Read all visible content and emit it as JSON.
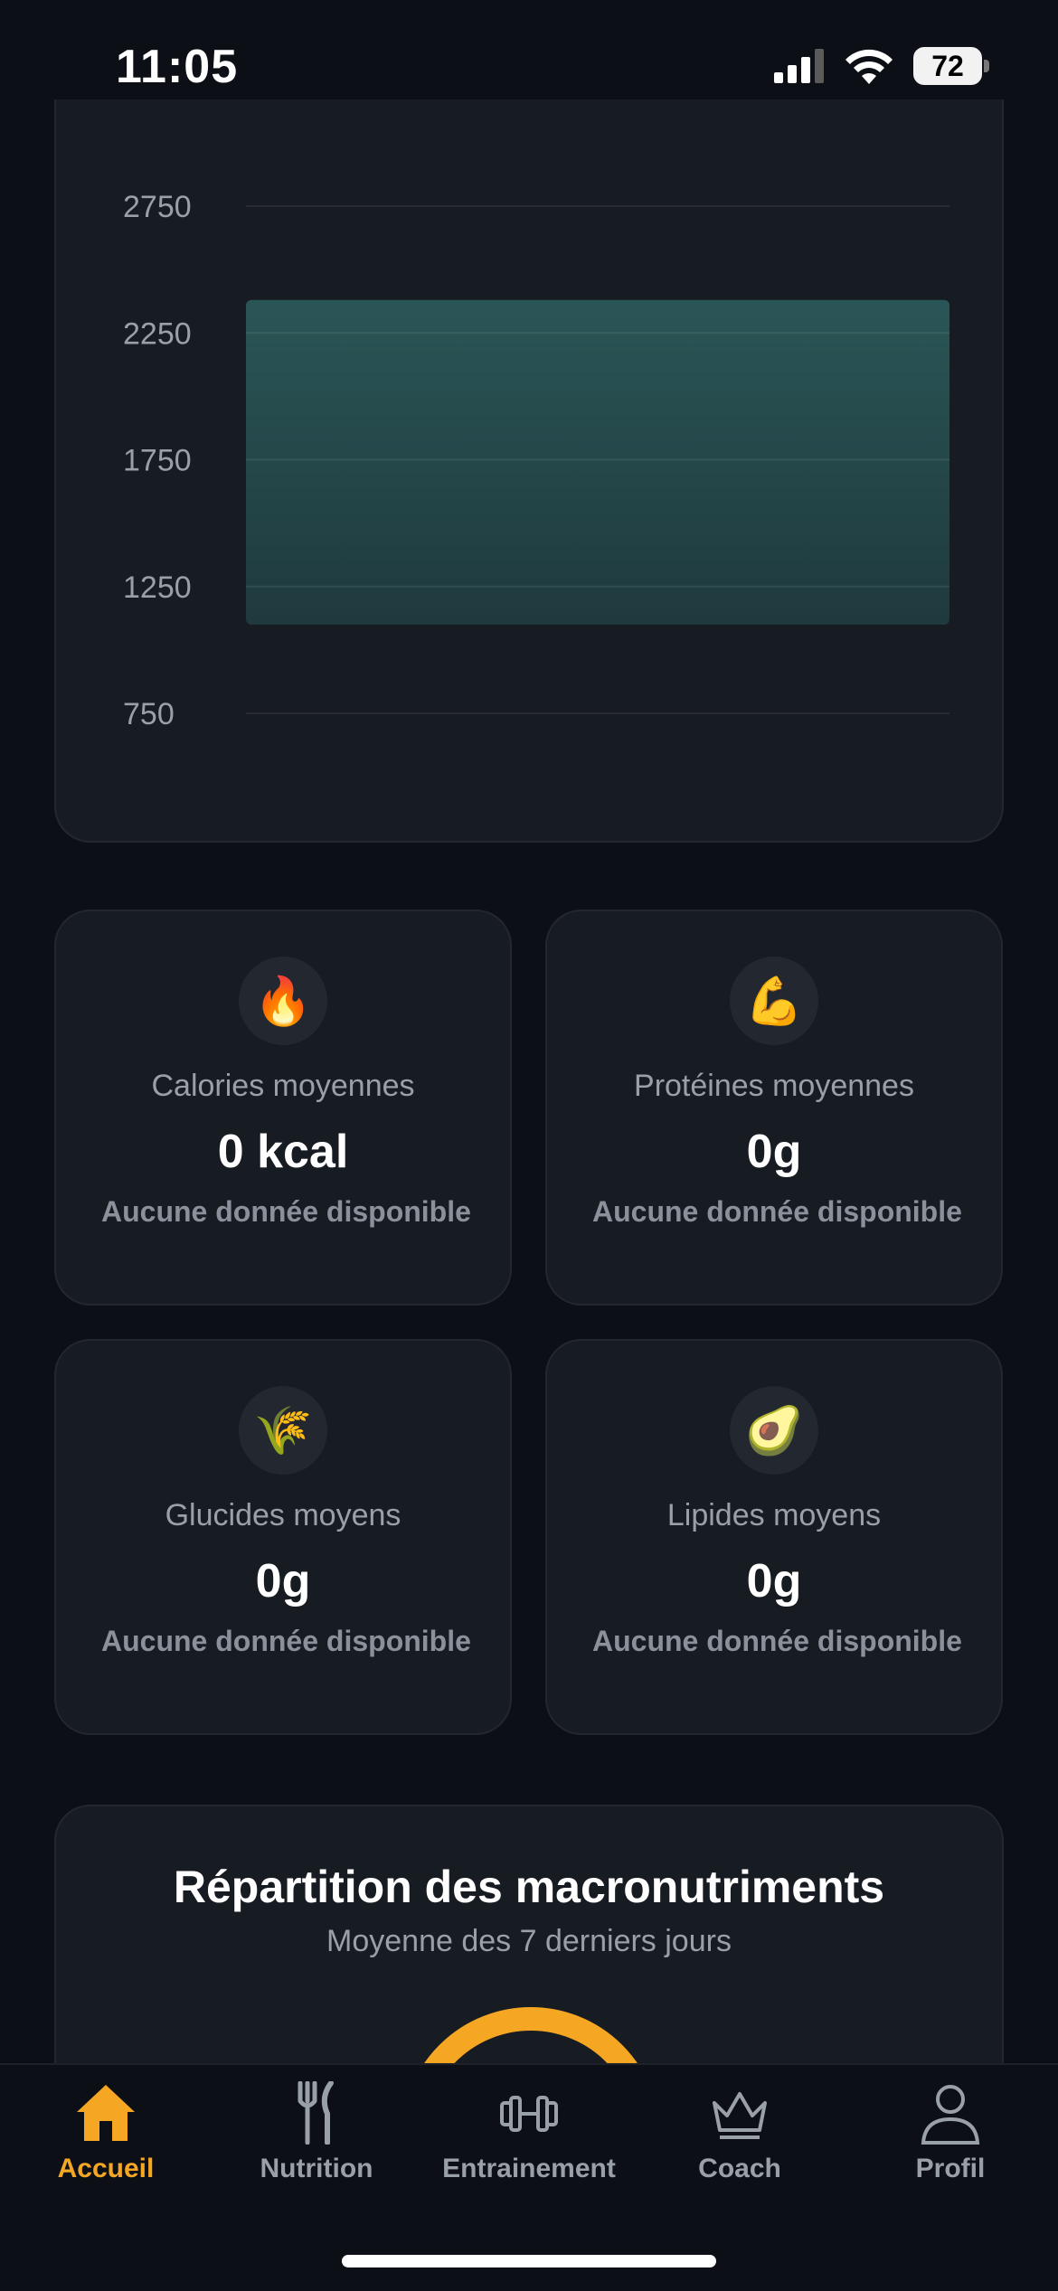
{
  "status_bar": {
    "time": "11:05",
    "battery": "72"
  },
  "chart_data": {
    "type": "area",
    "y_ticks": [
      "2750",
      "2250",
      "1750",
      "1250",
      "750"
    ],
    "ylim": [
      750,
      2750
    ],
    "series": [
      {
        "values": [
          2380,
          2380
        ]
      }
    ],
    "baseline": 1100,
    "grid": true,
    "color": "#2a5556"
  },
  "stats": [
    {
      "icon": "🔥",
      "label": "Calories moyennes",
      "value": "0 kcal",
      "note": "Aucune donnée disponible"
    },
    {
      "icon": "💪",
      "label": "Protéines moyennes",
      "value": "0g",
      "note": "Aucune donnée disponible"
    },
    {
      "icon": "🌾",
      "label": "Glucides moyens",
      "value": "0g",
      "note": "Aucune donnée disponible"
    },
    {
      "icon": "🥑",
      "label": "Lipides moyens",
      "value": "0g",
      "note": "Aucune donnée disponible"
    }
  ],
  "macro": {
    "title": "Répartition des macronutriments",
    "subtitle": "Moyenne des 7 derniers jours"
  },
  "tabs": [
    {
      "label": "Accueil",
      "icon": "home-icon",
      "active": true
    },
    {
      "label": "Nutrition",
      "icon": "fork-knife-icon"
    },
    {
      "label": "Entrainement",
      "icon": "dumbbell-icon"
    },
    {
      "label": "Coach",
      "icon": "crown-icon"
    },
    {
      "label": "Profil",
      "icon": "person-icon"
    }
  ],
  "colors": {
    "accent": "#f5a623",
    "background": "#0c0f15",
    "card": "#171b22"
  }
}
